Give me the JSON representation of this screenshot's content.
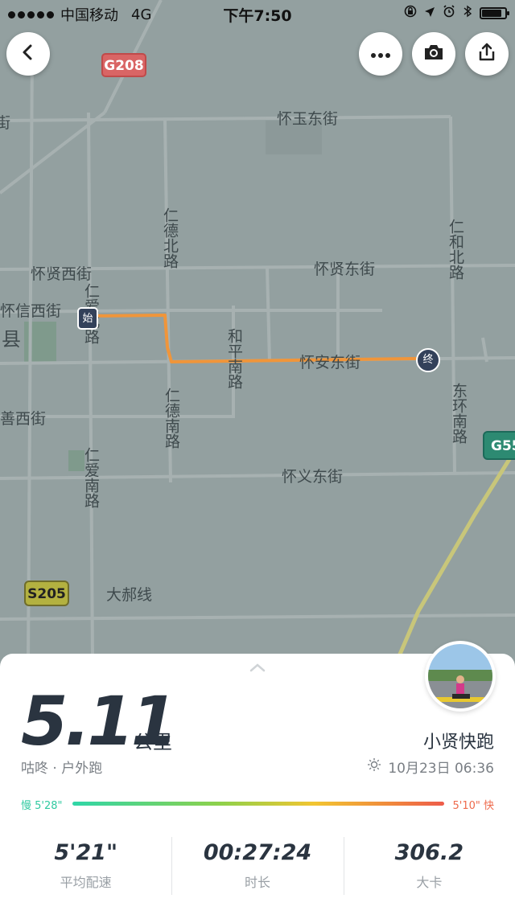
{
  "status_bar": {
    "carrier": "中国移动",
    "network": "4G",
    "time": "下午7:50",
    "battery_level": 0.85
  },
  "toolbar": {
    "back_icon": "chevron-left-icon",
    "more_icon": "ellipsis-icon",
    "camera_icon": "camera-icon",
    "share_icon": "share-icon"
  },
  "map": {
    "streets": [
      "怀玉东街",
      "仁德北路",
      "仁和北路",
      "怀贤西街",
      "怀贤东街",
      "怀信西街",
      "仁爱北路",
      "和平南路",
      "怀安东街",
      "东环南路",
      "仁德南路",
      "善西街",
      "仁爱南路",
      "怀义东街",
      "大郝线",
      "县",
      "街"
    ],
    "shields": {
      "g208": "G208",
      "s205": "S205",
      "g55": "G55"
    },
    "start_marker": "始",
    "end_marker": "终",
    "route_color": "#f0953a",
    "background_color": "#93a0a0"
  },
  "summary": {
    "distance": "5.11",
    "distance_unit": "公里",
    "activity": "咕咚 · 户外跑",
    "username": "小贤快跑",
    "date": "10月23日 06:36",
    "pace_slow": "慢 5'28\"",
    "pace_fast": "5'10\" 快",
    "stats": [
      {
        "value": "5'21\"",
        "label": "平均配速"
      },
      {
        "value": "00:27:24",
        "label": "时长"
      },
      {
        "value": "306.2",
        "label": "大卡"
      }
    ]
  }
}
